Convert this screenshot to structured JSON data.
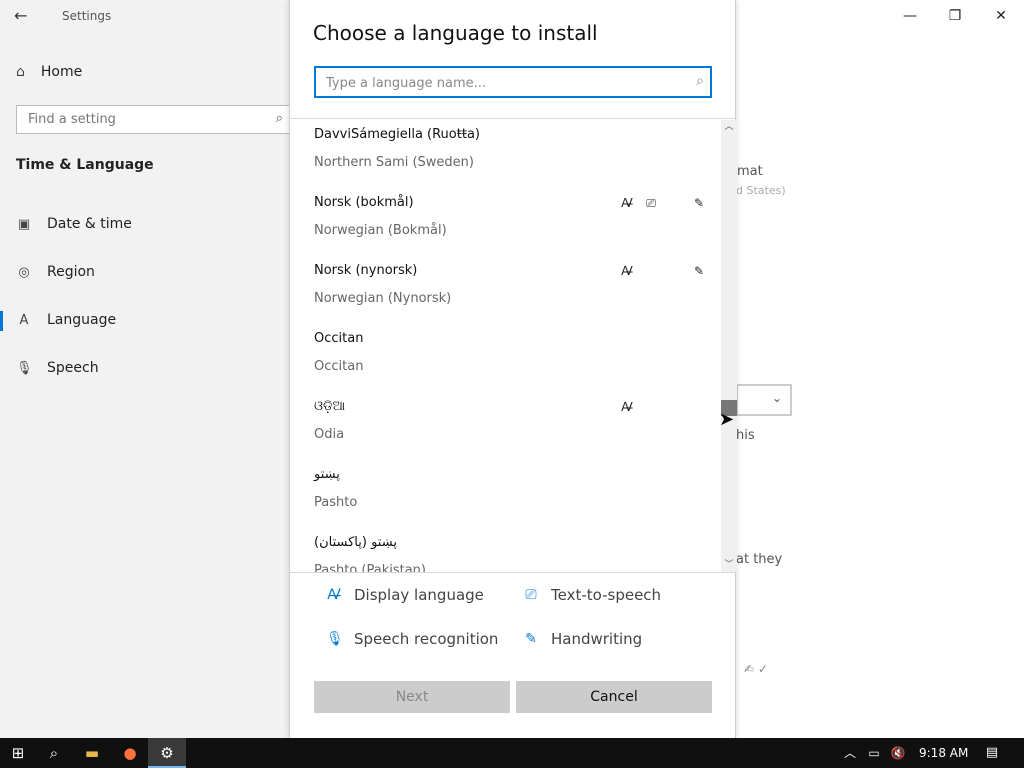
{
  "settings": {
    "title": "Settings",
    "home_label": "Home",
    "search_placeholder": "Find a setting",
    "section_title": "Time & Language",
    "nav": [
      {
        "label": "Date & time"
      },
      {
        "label": "Region"
      },
      {
        "label": "Language"
      },
      {
        "label": "Speech"
      }
    ],
    "bg_fragments": {
      "format": "mat",
      "states": "d States)",
      "his": "his",
      "they": "at they"
    }
  },
  "dialog": {
    "title": "Choose a language to install",
    "search_placeholder": "Type a language name...",
    "languages": [
      {
        "native": "DavviSámegiella (Ruoŧŧa)",
        "english": "Northern Sami (Sweden)",
        "display": false,
        "tts": false,
        "handwriting": false
      },
      {
        "native": "Norsk (bokmål)",
        "english": "Norwegian (Bokmål)",
        "display": true,
        "tts": true,
        "handwriting": true
      },
      {
        "native": "Norsk (nynorsk)",
        "english": "Norwegian (Nynorsk)",
        "display": true,
        "tts": false,
        "handwriting": true
      },
      {
        "native": "Occitan",
        "english": "Occitan",
        "display": false,
        "tts": false,
        "handwriting": false
      },
      {
        "native": "ଓଡ଼ିଆ",
        "english": "Odia",
        "display": true,
        "tts": false,
        "handwriting": false
      },
      {
        "native": "پښتو",
        "english": "Pashto",
        "display": false,
        "tts": false,
        "handwriting": false
      },
      {
        "native": "(پاکستان) پښتو",
        "english": "Pashto (Pakistan)",
        "display": false,
        "tts": false,
        "handwriting": false
      }
    ],
    "legend": {
      "display_language": "Display language",
      "text_to_speech": "Text-to-speech",
      "speech_recognition": "Speech recognition",
      "handwriting": "Handwriting"
    },
    "next_label": "Next",
    "cancel_label": "Cancel"
  },
  "taskbar": {
    "time": "9:18 AM"
  },
  "colors": {
    "accent": "#0078d7",
    "button_bg": "#cccccc",
    "taskbar_bg": "#101010"
  }
}
